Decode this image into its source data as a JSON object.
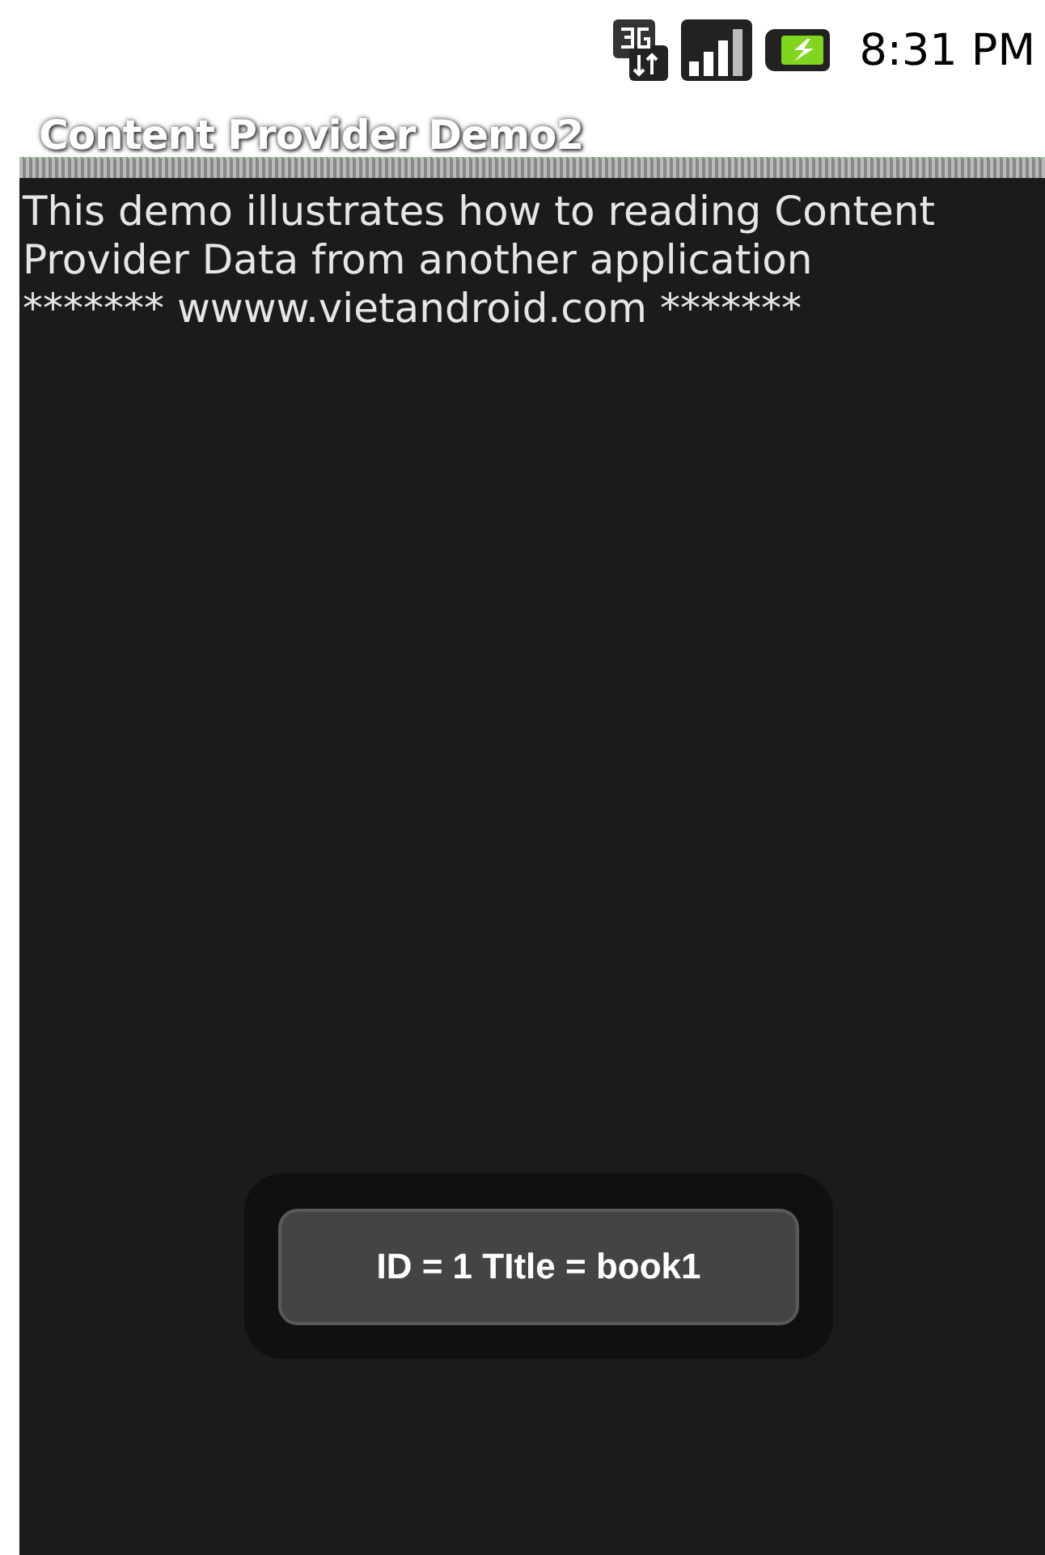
{
  "status_bar": {
    "time": "8:31 PM"
  },
  "window": {
    "title": "Content Provider Demo2"
  },
  "content": {
    "lines": [
      "This demo illustrates how to reading Content",
      "Provider Data from another application",
      "******* wwww.vietandroid.com *******"
    ]
  },
  "toast": {
    "text": "ID = 1 TItle = book1"
  }
}
